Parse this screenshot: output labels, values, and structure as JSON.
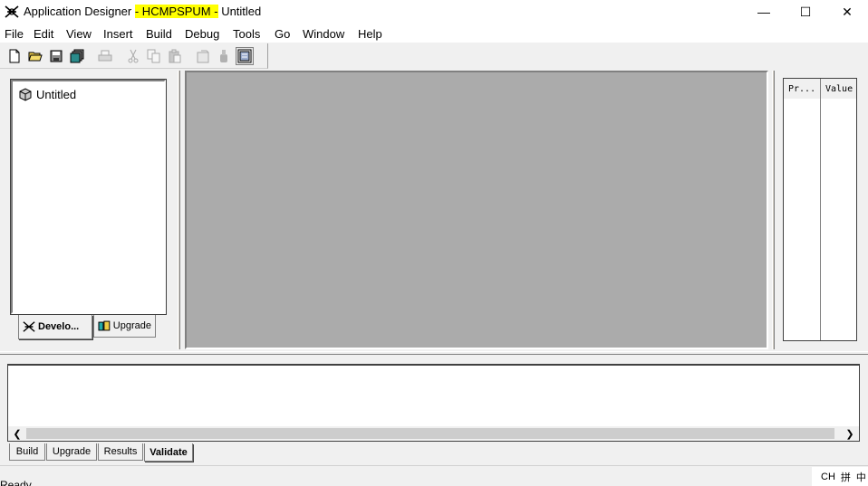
{
  "window": {
    "title_prefix": "Application Designer ",
    "title_highlight": "- HCMPSPUM -",
    "title_suffix": " Untitled",
    "controls": {
      "minimize": "—",
      "maximize": "☐",
      "close": "✕"
    }
  },
  "menu": [
    "File",
    "Edit",
    "View",
    "Insert",
    "Build",
    "Debug",
    "Tools",
    "Go",
    "Window",
    "Help"
  ],
  "toolbar": {
    "icons": [
      "new-icon",
      "open-icon",
      "save-icon",
      "save-all-icon",
      "print-icon",
      "cut-icon",
      "copy-icon",
      "paste-icon",
      "properties-icon",
      "find-icon",
      "project-workspace-icon"
    ]
  },
  "project_tree": {
    "root_label": "Untitled"
  },
  "left_tabs": {
    "development": "Develo...",
    "upgrade": "Upgrade"
  },
  "properties": {
    "col_property": "Pr...",
    "col_value": "Value"
  },
  "output_tabs": [
    "Build",
    "Upgrade",
    "Results",
    "Validate"
  ],
  "status": {
    "text": "Ready"
  },
  "ime": {
    "lang": "CH",
    "mode": "拼",
    "extra": "中"
  },
  "colors": {
    "highlight": "#ffff00",
    "mdi_background": "#ababab"
  }
}
